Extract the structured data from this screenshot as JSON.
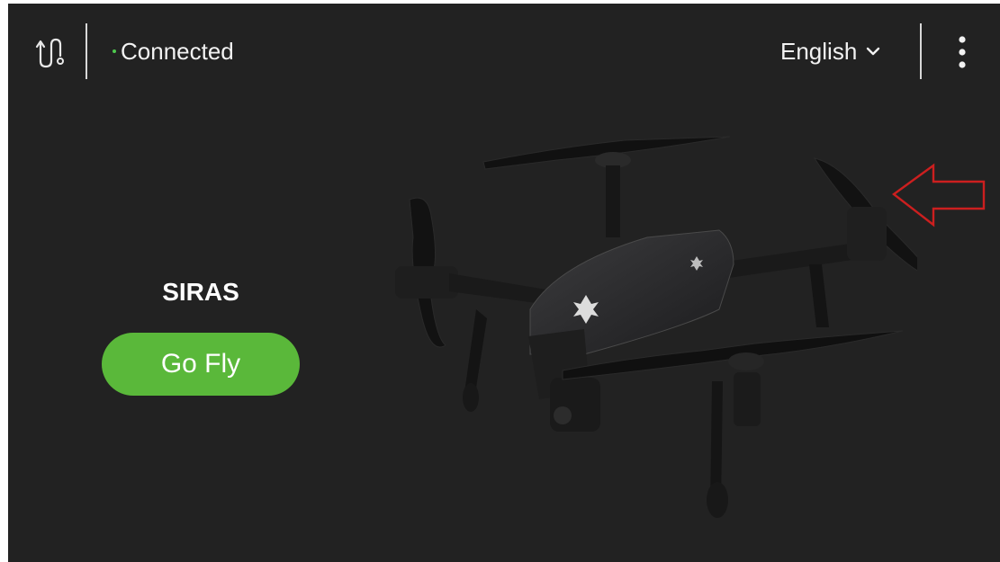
{
  "topbar": {
    "status_text": "Connected",
    "status_color": "#4ec94e",
    "language": "English",
    "icons": {
      "route": "route-icon",
      "chevron": "chevron-down-icon",
      "menu": "more-vertical-icon"
    }
  },
  "main": {
    "drone_name": "SIRAS",
    "go_fly_label": "Go Fly",
    "accent_color": "#5ab83a",
    "image": "drone-image",
    "annotation": "red-arrow-annotation"
  },
  "colors": {
    "background": "#222222",
    "arrow": "#cc1f1f"
  }
}
